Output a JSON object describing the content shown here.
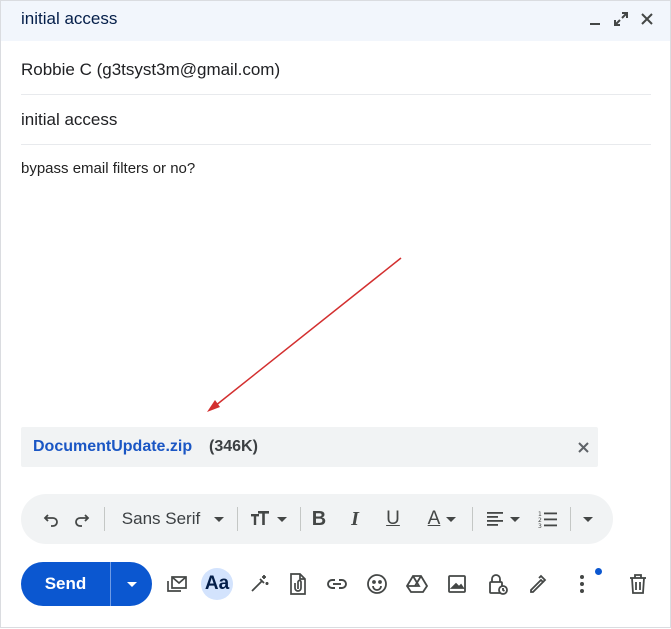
{
  "window": {
    "title": "initial access",
    "controls": [
      "minimize-icon",
      "expand-icon",
      "close-icon"
    ]
  },
  "compose": {
    "to": "Robbie C (g3tsyst3m@gmail.com)",
    "subject": "initial access",
    "body": "bypass email filters or no?"
  },
  "attachment": {
    "name": "DocumentUpdate.zip",
    "size": "(346K)"
  },
  "toolbar": {
    "font_name": "Sans Serif",
    "icons": [
      "undo-icon",
      "redo-icon",
      "text-size-icon",
      "bold-icon",
      "italic-icon",
      "underline-icon",
      "text-color-icon",
      "align-icon",
      "numbered-list-icon",
      "more-formatting-icon"
    ]
  },
  "bottom_bar": {
    "send_label": "Send",
    "formatting_label": "Aa",
    "icons": [
      "send-options-icon",
      "confidential-mail-icon",
      "formatting-icon",
      "help-me-write-icon",
      "attach-file-icon",
      "insert-link-icon",
      "emoji-icon",
      "google-drive-icon",
      "insert-photo-icon",
      "lock-icon",
      "signature-icon",
      "more-options-icon",
      "discard-icon"
    ]
  },
  "colors": {
    "accent": "#0b57d0",
    "header_bg": "#f2f6fc",
    "attachment_link": "#1a56c4",
    "annotation_arrow": "#d32f2f"
  }
}
